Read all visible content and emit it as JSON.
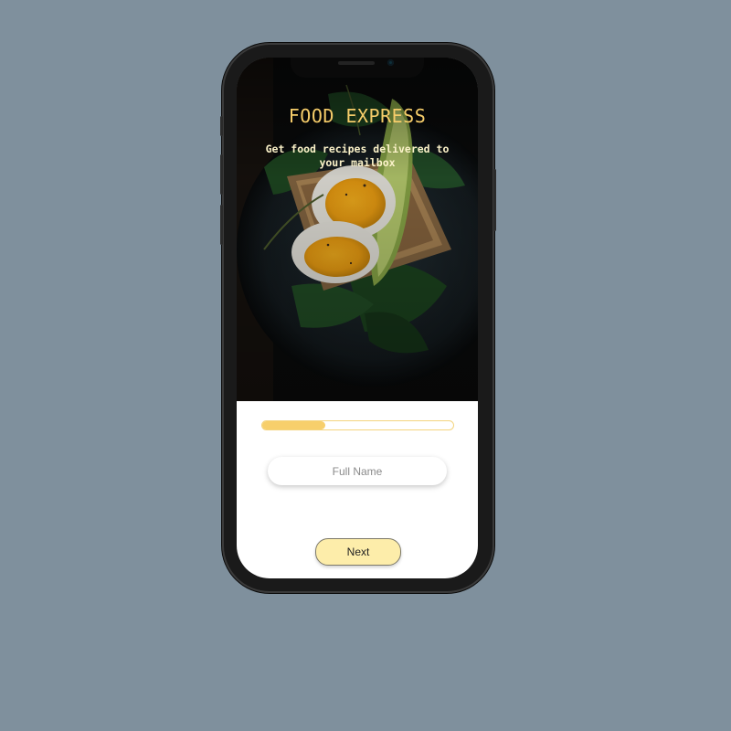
{
  "app": {
    "title": "FOOD EXPRESS",
    "subtitle": "Get food recipes delivered to your mailbox"
  },
  "form": {
    "progress": 0.33,
    "full_name": {
      "value": "",
      "placeholder": "Full Name"
    },
    "next_label": "Next"
  },
  "colors": {
    "background": "#7f909d",
    "accent": "#f7cf6b",
    "title": "#f6cd6a",
    "button": "#fdedaa"
  },
  "icons": {
    "hero_image": "egg-avocado-toast-image"
  }
}
